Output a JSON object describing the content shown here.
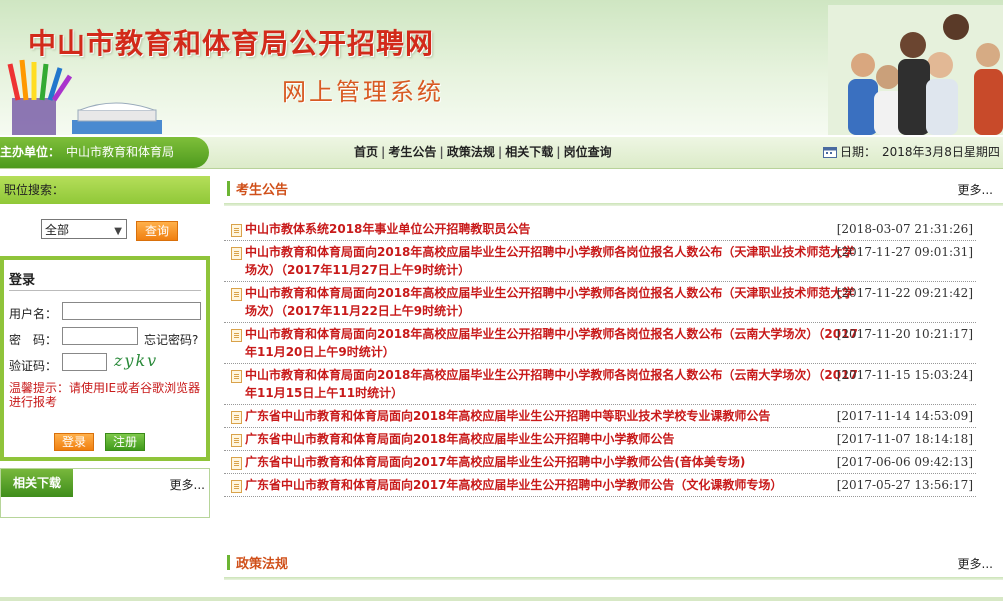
{
  "header": {
    "title": "中山市教育和体育局公开招聘网",
    "subtitle": "网上管理系统"
  },
  "navbar": {
    "host_label": "主办单位：",
    "host_value": "中山市教育和体育局",
    "links": [
      "首页",
      "考生公告",
      "政策法规",
      "相关下载",
      "岗位查询"
    ],
    "date_label": "日期：",
    "date_value": "2018年3月8日星期四"
  },
  "search": {
    "label": "职位搜索：",
    "select_value": "全部",
    "button": "查询"
  },
  "login": {
    "title": "登录",
    "username_label": "用户名：",
    "password_label": "密　码：",
    "forgot": "忘记密码?",
    "captcha_label": "验证码：",
    "captcha_text": "zykv",
    "tip": "温馨提示：请使用IE或者谷歌浏览器进行报考",
    "login_button": "登录",
    "register_button": "注册"
  },
  "downloads": {
    "title": "相关下载",
    "more": "更多..."
  },
  "notices": {
    "title": "考生公告",
    "more": "更多...",
    "items": [
      {
        "title": "中山市教体系统2018年事业单位公开招聘教职员公告",
        "date": "[2018-03-07 21:31:26]"
      },
      {
        "title": "中山市教育和体育局面向2018年高校应届毕业生公开招聘中小学教师各岗位报名人数公布（天津职业技术师范大学场次）（2017年11月27日上午9时统计）",
        "date": "[2017-11-27 09:01:31]"
      },
      {
        "title": "中山市教育和体育局面向2018年高校应届毕业生公开招聘中小学教师各岗位报名人数公布（天津职业技术师范大学场次）（2017年11月22日上午9时统计）",
        "date": "[2017-11-22 09:21:42]"
      },
      {
        "title": "中山市教育和体育局面向2018年高校应届毕业生公开招聘中小学教师各岗位报名人数公布（云南大学场次）（2017年11月20日上午9时统计）",
        "date": "[2017-11-20 10:21:17]"
      },
      {
        "title": "中山市教育和体育局面向2018年高校应届毕业生公开招聘中小学教师各岗位报名人数公布（云南大学场次）（2017年11月15日上午11时统计）",
        "date": "[2017-11-15 15:03:24]"
      },
      {
        "title": "广东省中山市教育和体育局面向2018年高校应届毕业生公开招聘中等职业技术学校专业课教师公告",
        "date": "[2017-11-14 14:53:09]"
      },
      {
        "title": "广东省中山市教育和体育局面向2018年高校应届毕业生公开招聘中小学教师公告",
        "date": "[2017-11-07 18:14:18]"
      },
      {
        "title": "广东省中山市教育和体育局面向2017年高校应届毕业生公开招聘中小学教师公告(音体美专场)",
        "date": "[2017-06-06 09:42:13]"
      },
      {
        "title": "广东省中山市教育和体育局面向2017年高校应届毕业生公开招聘中小学教师公告（文化课教师专场）",
        "date": "[2017-05-27 13:56:17]"
      }
    ]
  },
  "policies": {
    "title": "政策法规",
    "more": "更多..."
  }
}
